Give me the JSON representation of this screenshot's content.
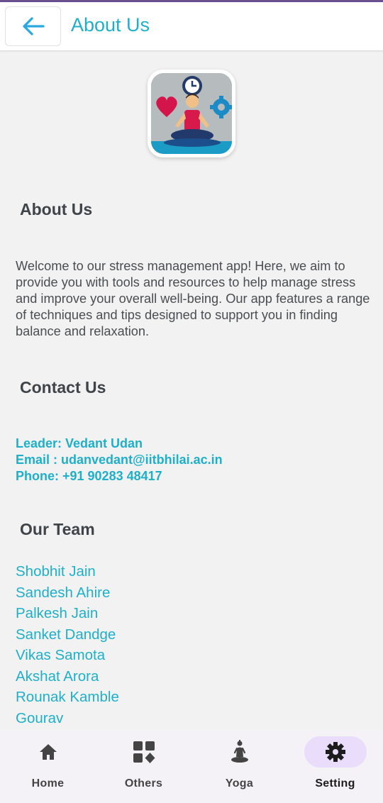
{
  "appbar": {
    "title": "About Us",
    "back_icon": "arrow-left-icon"
  },
  "logo": {
    "icon": "meditation-app-logo"
  },
  "about": {
    "heading": "About Us",
    "text": "Welcome to our stress management app! Here, we aim to provide you with tools and resources to help manage stress and improve your overall well-being. Our app features a range of techniques and tips designed to support you in finding balance and relaxation."
  },
  "contact": {
    "heading": "Contact Us",
    "leader": "Leader: Vedant Udan",
    "email": "Email  : udanvedant@iitbhilai.ac.in",
    "phone": "Phone: +91 90283 48417"
  },
  "team": {
    "heading": "Our Team",
    "members": [
      "Shobhit Jain",
      "Sandesh Ahire",
      "Palkesh Jain",
      "Sanket Dandge",
      "Vikas Samota",
      "Akshat Arora",
      "Rounak Kamble",
      "Gourav"
    ]
  },
  "nav": {
    "items": [
      {
        "label": "Home",
        "icon": "home-icon",
        "active": false
      },
      {
        "label": "Others",
        "icon": "grid-shapes-icon",
        "active": false
      },
      {
        "label": "Yoga",
        "icon": "yoga-pose-icon",
        "active": false
      },
      {
        "label": "Setting",
        "icon": "gear-icon",
        "active": true
      }
    ]
  },
  "colors": {
    "accent": "#1fb0c9",
    "nav_active_bg": "#e9ddfb",
    "top_bar": "#6a4f8f"
  }
}
